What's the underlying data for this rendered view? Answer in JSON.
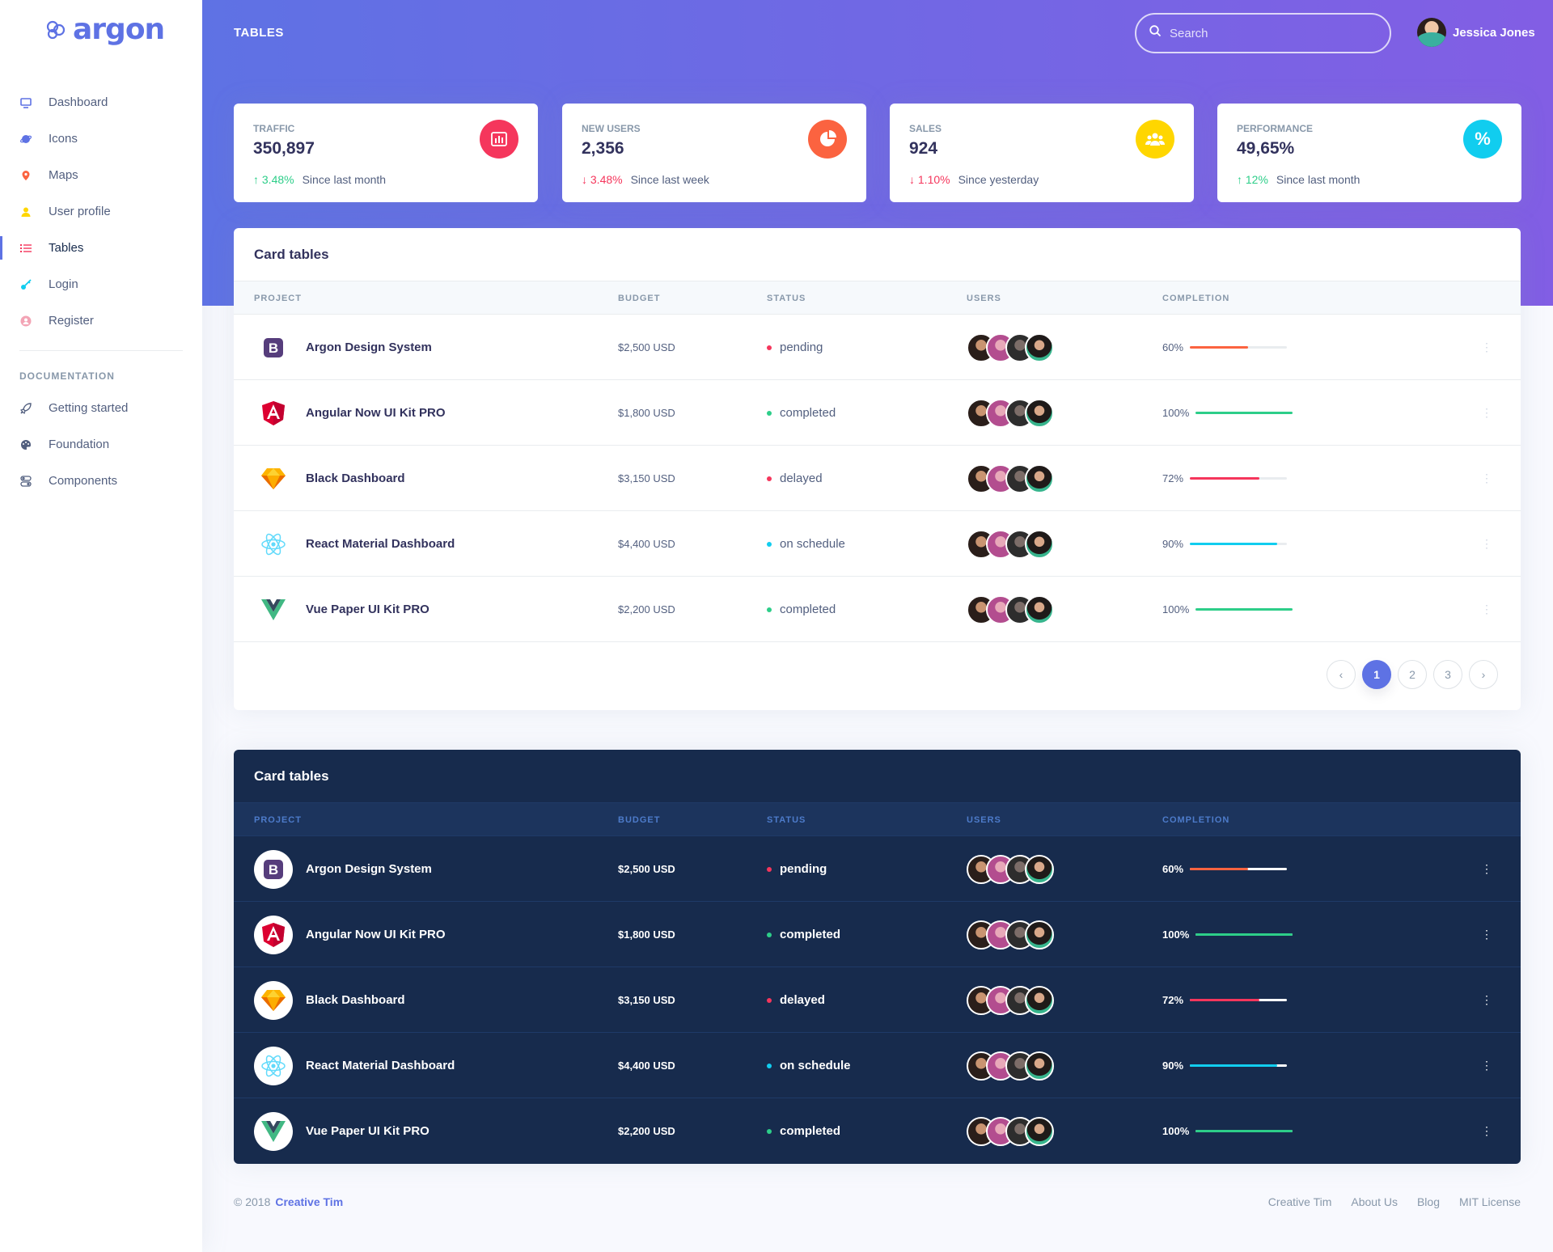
{
  "brand": {
    "name": "argon",
    "color": "#5e72e4"
  },
  "header": {
    "title": "TABLES",
    "search_placeholder": "Search",
    "user_name": "Jessica Jones",
    "gradient": [
      "#5e72e4",
      "#825ee4"
    ]
  },
  "sidebar": {
    "items": [
      {
        "label": "Dashboard",
        "icon": "tv-icon",
        "color": "#5e72e4"
      },
      {
        "label": "Icons",
        "icon": "planet-icon",
        "color": "#5e72e4"
      },
      {
        "label": "Maps",
        "icon": "pin-icon",
        "color": "#fb6340"
      },
      {
        "label": "User profile",
        "icon": "single-user-icon",
        "color": "#ffd600"
      },
      {
        "label": "Tables",
        "icon": "bullet-list-icon",
        "color": "#f5365c"
      },
      {
        "label": "Login",
        "icon": "key-icon",
        "color": "#11cdef"
      },
      {
        "label": "Register",
        "icon": "circle-user-icon",
        "color": "#f3a4b5"
      }
    ],
    "doc_heading": "DOCUMENTATION",
    "doc_items": [
      {
        "label": "Getting started",
        "icon": "spaceship-icon"
      },
      {
        "label": "Foundation",
        "icon": "palette-icon"
      },
      {
        "label": "Components",
        "icon": "ui-components-icon"
      }
    ]
  },
  "stats": [
    {
      "label": "TRAFFIC",
      "value": "350,897",
      "change": "3.48%",
      "direction": "up",
      "since": "Since last month",
      "icon": "chart-bar-icon",
      "color": "#f5365c"
    },
    {
      "label": "NEW USERS",
      "value": "2,356",
      "change": "3.48%",
      "direction": "down",
      "since": "Since last week",
      "icon": "chart-pie-icon",
      "color": "#fb6340"
    },
    {
      "label": "SALES",
      "value": "924",
      "change": "1.10%",
      "direction": "down",
      "since": "Since yesterday",
      "icon": "users-icon",
      "color": "#ffd600"
    },
    {
      "label": "PERFORMANCE",
      "value": "49,65%",
      "change": "12%",
      "direction": "up",
      "since": "Since last month",
      "icon": "percent-icon",
      "color": "#11cdef"
    }
  ],
  "table": {
    "title": "Card tables",
    "columns": [
      "PROJECT",
      "BUDGET",
      "STATUS",
      "USERS",
      "COMPLETION"
    ],
    "rows": [
      {
        "project": "Argon Design System",
        "logo": "bootstrap-logo-icon",
        "budget": "$2,500 USD",
        "status": "pending",
        "status_color": "#f5365c",
        "completion_label": "60%",
        "completion": 60,
        "bar_color": "#fb6340"
      },
      {
        "project": "Angular Now UI Kit PRO",
        "logo": "angular-logo-icon",
        "budget": "$1,800 USD",
        "status": "completed",
        "status_color": "#2dce89",
        "completion_label": "100%",
        "completion": 100,
        "bar_color": "#2dce89"
      },
      {
        "project": "Black Dashboard",
        "logo": "sketch-logo-icon",
        "budget": "$3,150 USD",
        "status": "delayed",
        "status_color": "#f5365c",
        "completion_label": "72%",
        "completion": 72,
        "bar_color": "#f5365c"
      },
      {
        "project": "React Material Dashboard",
        "logo": "react-logo-icon",
        "budget": "$4,400 USD",
        "status": "on schedule",
        "status_color": "#11cdef",
        "completion_label": "90%",
        "completion": 90,
        "bar_color": "#11cdef"
      },
      {
        "project": "Vue Paper UI Kit PRO",
        "logo": "vue-logo-icon",
        "budget": "$2,200 USD",
        "status": "completed",
        "status_color": "#2dce89",
        "completion_label": "100%",
        "completion": 100,
        "bar_color": "#2dce89"
      }
    ],
    "pagination": {
      "prev": "‹",
      "pages": [
        "1",
        "2",
        "3"
      ],
      "active": "1",
      "next": "›"
    }
  },
  "dark_table": {
    "title": "Card tables"
  },
  "footer": {
    "copyright": "© 2018",
    "brand_link": "Creative Tim",
    "links": [
      "Creative Tim",
      "About Us",
      "Blog",
      "MIT License"
    ]
  }
}
